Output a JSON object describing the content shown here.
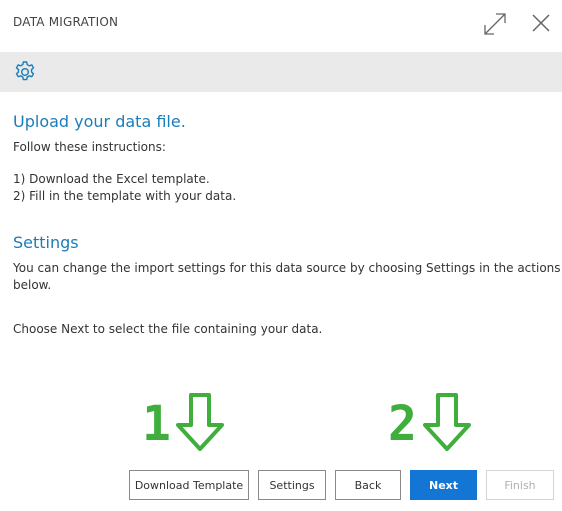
{
  "window": {
    "title": "DATA MIGRATION"
  },
  "icons": {
    "expand": "expand-icon",
    "close": "close-icon",
    "settings": "gear-icon",
    "arrow": "down-arrow-outline-icon"
  },
  "content": {
    "upload_heading": "Upload your data file.",
    "instructions_intro": "Follow these instructions:",
    "step1": "1) Download the Excel template.",
    "step2": "2) Fill in the template with your data.",
    "settings_heading": "Settings",
    "settings_text_line1": "You can change the import settings for this data source by choosing Settings in the actions",
    "settings_text_line2": "below.",
    "next_text": "Choose Next to select the file containing your data."
  },
  "annotations": {
    "one": "1",
    "two": "2",
    "color": "#3fae3d"
  },
  "actions": {
    "download_template": "Download Template",
    "settings": "Settings",
    "back": "Back",
    "next": "Next",
    "finish": "Finish"
  },
  "colors": {
    "accent": "#1b7db8",
    "primary_button": "#1476d4",
    "toolbar": "#eaeaea"
  }
}
